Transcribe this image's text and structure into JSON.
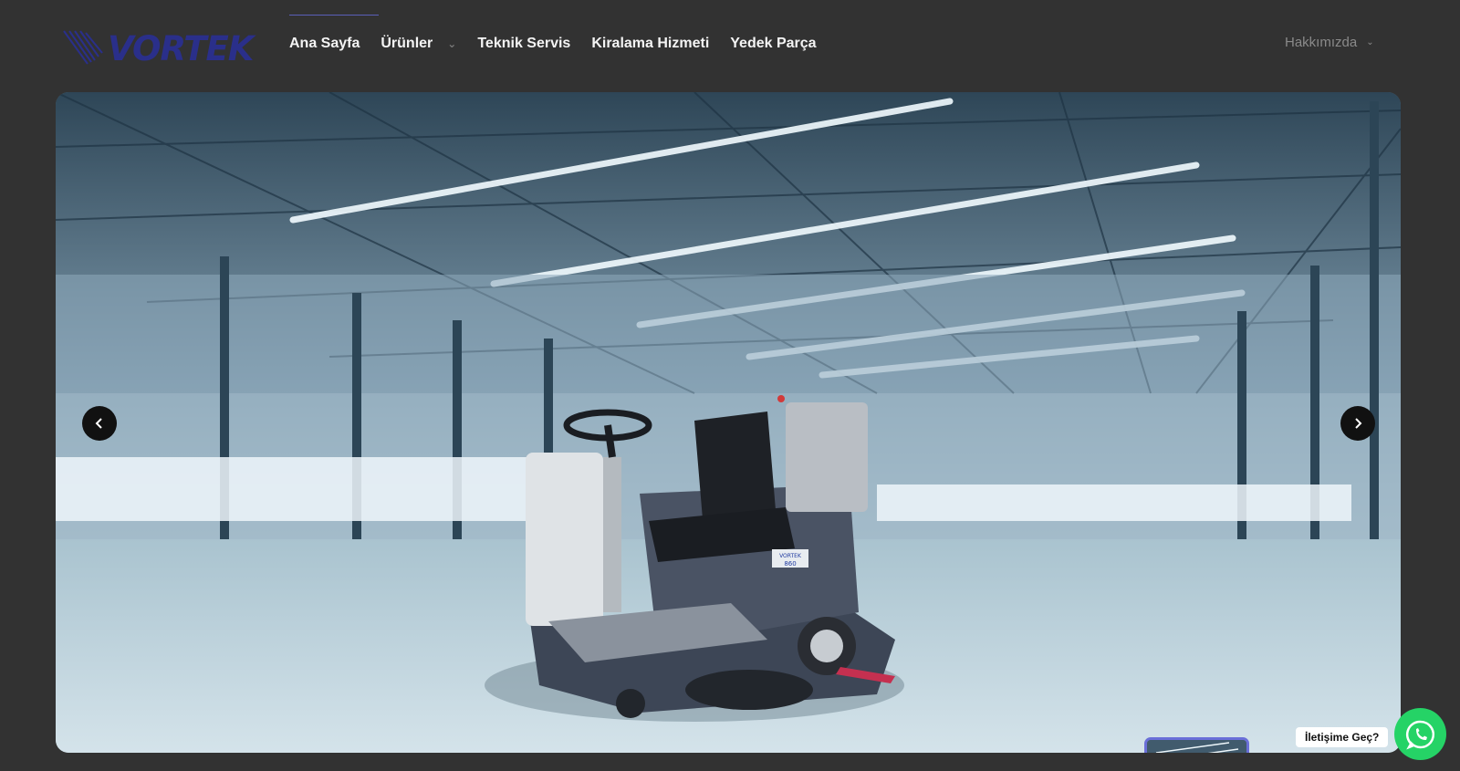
{
  "brand": {
    "logo_text": "VORTEK"
  },
  "nav": {
    "items": [
      {
        "label": "Ana Sayfa"
      },
      {
        "label": "Ürünler",
        "has_dropdown": true
      },
      {
        "label": "Teknik Servis"
      },
      {
        "label": "Kiralama Hizmeti"
      },
      {
        "label": "Yedek Parça"
      }
    ],
    "about_label": "Hakkımızda"
  },
  "hero": {
    "product_badge_brand": "VORTEK",
    "product_badge_model": "860",
    "arrows": {
      "prev_icon": "chevron-left-icon",
      "next_icon": "chevron-right-icon"
    }
  },
  "contact": {
    "badge_label": "İletişime Geç?",
    "icon": "whatsapp-icon"
  },
  "colors": {
    "background": "#323232",
    "logo": "#2a2f8a",
    "accent": "#6a6fd8",
    "whatsapp": "#25d366"
  }
}
